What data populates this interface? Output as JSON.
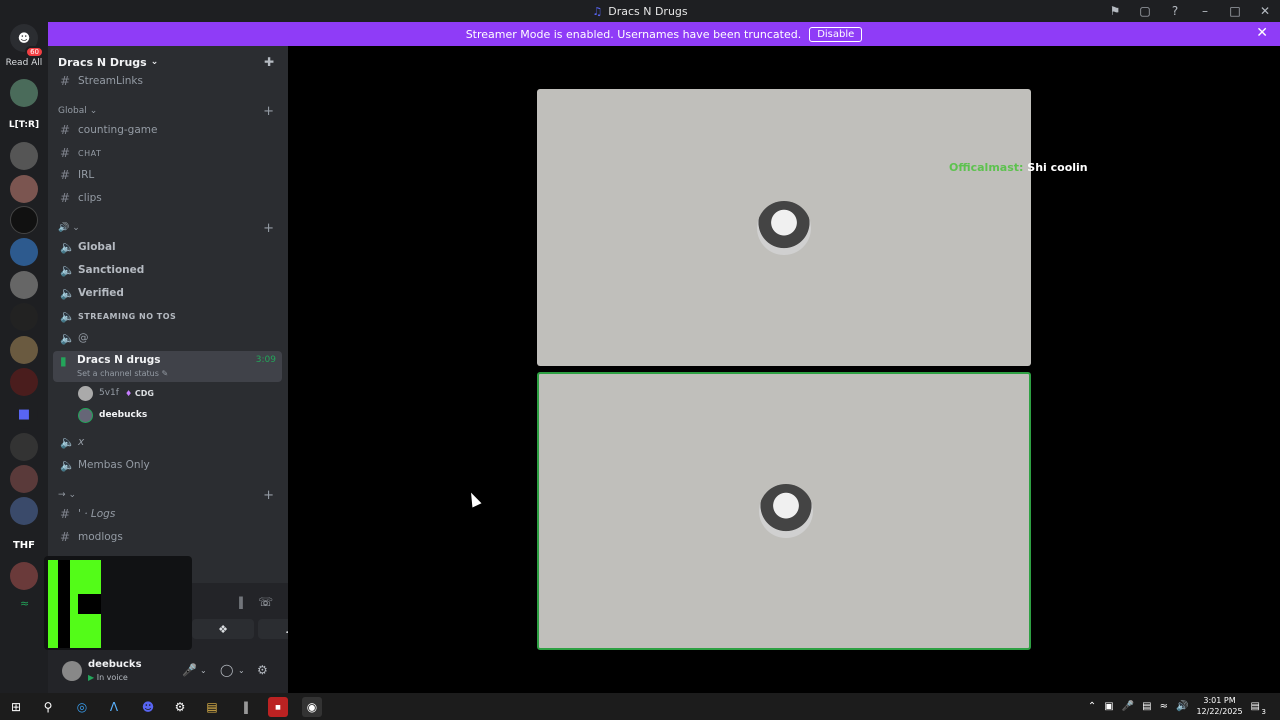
{
  "window": {
    "title": "Dracs N Drugs"
  },
  "banner": {
    "message": "Streamer Mode is enabled. Usernames have been truncated.",
    "disable_label": "Disable",
    "color": "#8f3cf7"
  },
  "guilds": {
    "badge_count": "60",
    "read_all_label": "Read All",
    "text_icons": [
      "L[T:R]",
      "THF"
    ]
  },
  "server": {
    "name": "Dracs N Drugs",
    "channels_top": [
      "StreamLinks"
    ],
    "category_global": "Global",
    "global_channels": [
      "counting-game",
      "CHAT",
      "IRL",
      "clips"
    ],
    "voice_channels": [
      "Global",
      "Sanctioned",
      "Verified",
      "STREAMING NO TOS",
      "@"
    ],
    "active_voice": {
      "name": "Dracs N drugs",
      "timer": "3:09",
      "status_placeholder": "Set a channel status",
      "users": [
        {
          "name": "5v1f",
          "tag": "CDG"
        },
        {
          "name": "deebucks",
          "tag": ""
        }
      ]
    },
    "more_voice": [
      "x",
      "Membas Only"
    ],
    "log_channels": [
      "' · Logs",
      "modlogs"
    ]
  },
  "user": {
    "name": "deebucks",
    "status": "In voice"
  },
  "stage": {
    "chat_name": "Officalmast:",
    "chat_message": "Shi coolin"
  },
  "taskbar": {
    "time": "3:01 PM",
    "date": "12/22/2025",
    "notif_count": "3"
  },
  "colors": {
    "speaking": "#2ea043",
    "kick_green": "#53fc18"
  }
}
